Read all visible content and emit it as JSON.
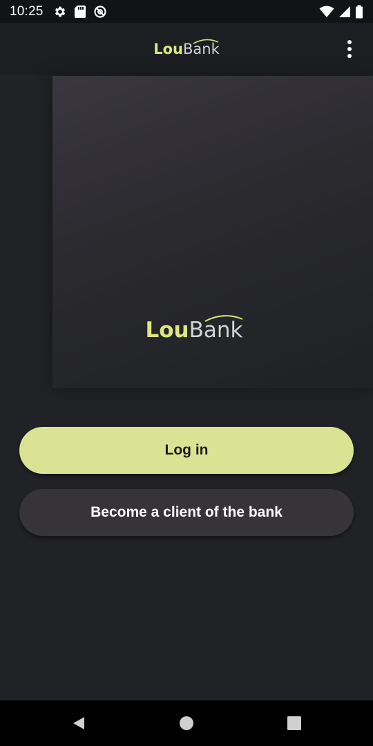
{
  "status_bar": {
    "time": "10:25",
    "left_icons": [
      "settings-icon",
      "sd-card-icon",
      "at-sign-icon"
    ],
    "right_icons": [
      "wifi-icon",
      "signal-icon",
      "battery-icon"
    ]
  },
  "app_bar": {
    "logo": {
      "part1": "Lou",
      "part2": "Bank"
    },
    "menu_icon": "more-vertical-icon"
  },
  "hero": {
    "logo": {
      "part1": "Lou",
      "part2": "Bank"
    }
  },
  "actions": {
    "login_label": "Log in",
    "register_label": "Become a client of the bank"
  },
  "nav_bar": {
    "icons": [
      "back-icon",
      "home-icon",
      "recents-icon"
    ]
  },
  "colors": {
    "background": "#202225",
    "accent": "#dae393",
    "logo_accent": "#dfe67f",
    "secondary_button": "#363439",
    "status_bar": "#121315"
  }
}
